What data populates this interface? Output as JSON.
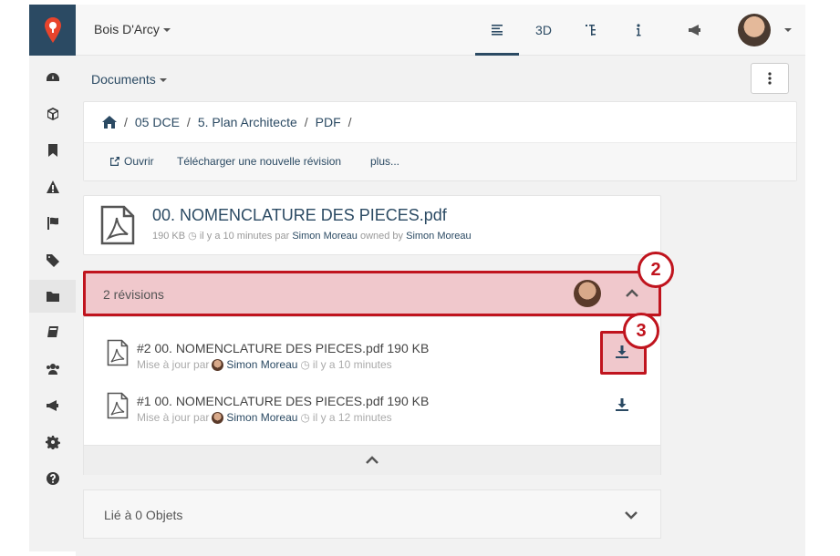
{
  "topbar": {
    "site_name": "Bois D'Arcy",
    "tabs": [
      {
        "icon": "list-icon",
        "label": ""
      },
      {
        "icon": "",
        "label": "3D"
      },
      {
        "icon": "tree-icon",
        "label": ""
      },
      {
        "icon": "info-icon",
        "label": ""
      },
      {
        "icon": "megaphone-icon",
        "label": ""
      }
    ]
  },
  "sidebar": {
    "items": [
      "dashboard-icon",
      "cube-icon",
      "bookmark-icon",
      "warning-icon",
      "flag-icon",
      "tags-icon",
      "folder-icon",
      "book-icon",
      "users-icon",
      "megaphone-icon",
      "gear-icon",
      "question-icon"
    ]
  },
  "documents": {
    "label": "Documents",
    "breadcrumb": [
      "05 DCE",
      "5. Plan Architecte",
      "PDF"
    ],
    "actions": {
      "open": "Ouvrir",
      "upload": "Télécharger une nouvelle révision",
      "more": "plus..."
    }
  },
  "file": {
    "title": "00. NOMENCLATURE DES PIECES.pdf",
    "size": "190 KB",
    "time": "il y a 10 minutes",
    "by": "par",
    "author": "Simon Moreau",
    "owned_by": "owned by",
    "owner": "Simon Moreau"
  },
  "revisions": {
    "header": "2 révisions",
    "items": [
      {
        "title": "#2 00. NOMENCLATURE DES PIECES.pdf 190 KB",
        "updated": "Mise à jour par",
        "author": "Simon Moreau",
        "time": "il y a 10 minutes"
      },
      {
        "title": "#1 00. NOMENCLATURE DES PIECES.pdf 190 KB",
        "updated": "Mise à jour par",
        "author": "Simon Moreau",
        "time": "il y a 12 minutes"
      }
    ]
  },
  "linked": {
    "label": "Lié à 0 Objets"
  },
  "callouts": {
    "two": "2",
    "three": "3"
  },
  "colors": {
    "accent": "#2b4a63",
    "highlight": "#c0141e",
    "highlight_fill": "#f0c8cc",
    "logo": "#e8442c"
  }
}
